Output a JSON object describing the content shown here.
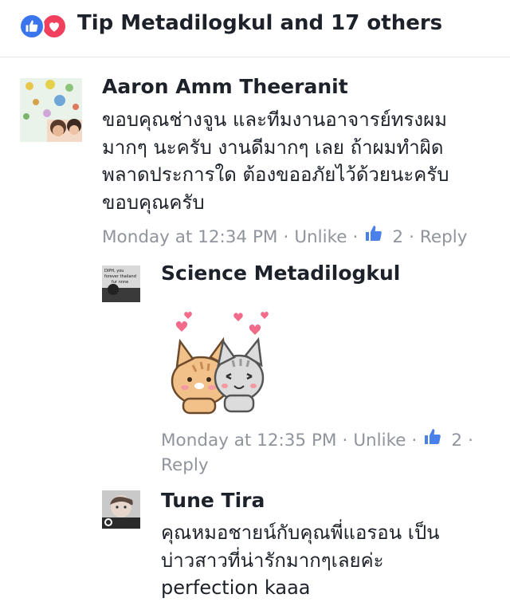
{
  "reactions": {
    "icons": [
      "like-icon",
      "love-icon"
    ],
    "text": "Tip Metadilogkul and 17 others",
    "colors": {
      "like": "#3a75ee",
      "love": "#f0405d"
    }
  },
  "comments": [
    {
      "author": "Aaron Amm Theeranit",
      "text": "ขอบคุณช่างจูน และทีมงานอาจารย์ทรงผม\nมากๆ นะครับ งานดีมากๆ เลย ถ้าผมทำผิด\nพลาดประการใด ต้องขออภัยไว้ด้วยนะครับ\nขอบคุณครับ",
      "time": "Monday at 12:34 PM",
      "unlike": "Unlike",
      "like_count": "2",
      "reply": "Reply"
    },
    {
      "author": "Science  Metadilogkul",
      "avatar_text": "DIPH, you  forever thailand  fur nnne",
      "sticker": "cat-couple-hearts-sticker",
      "time": "Monday at 12:35 PM",
      "unlike": "Unlike",
      "like_count": "2",
      "reply": "Reply"
    },
    {
      "author": "Tune Tira",
      "text": "คุณหมอชายน์กับคุณพี่แอรอน เป็น\nบ่าวสาวที่น่ารักมากๆเลยค่ะ\nperfection kaaa"
    }
  ],
  "colors": {
    "text": "#1d2129",
    "meta": "#90949c",
    "thumb": "#4a80ea"
  }
}
